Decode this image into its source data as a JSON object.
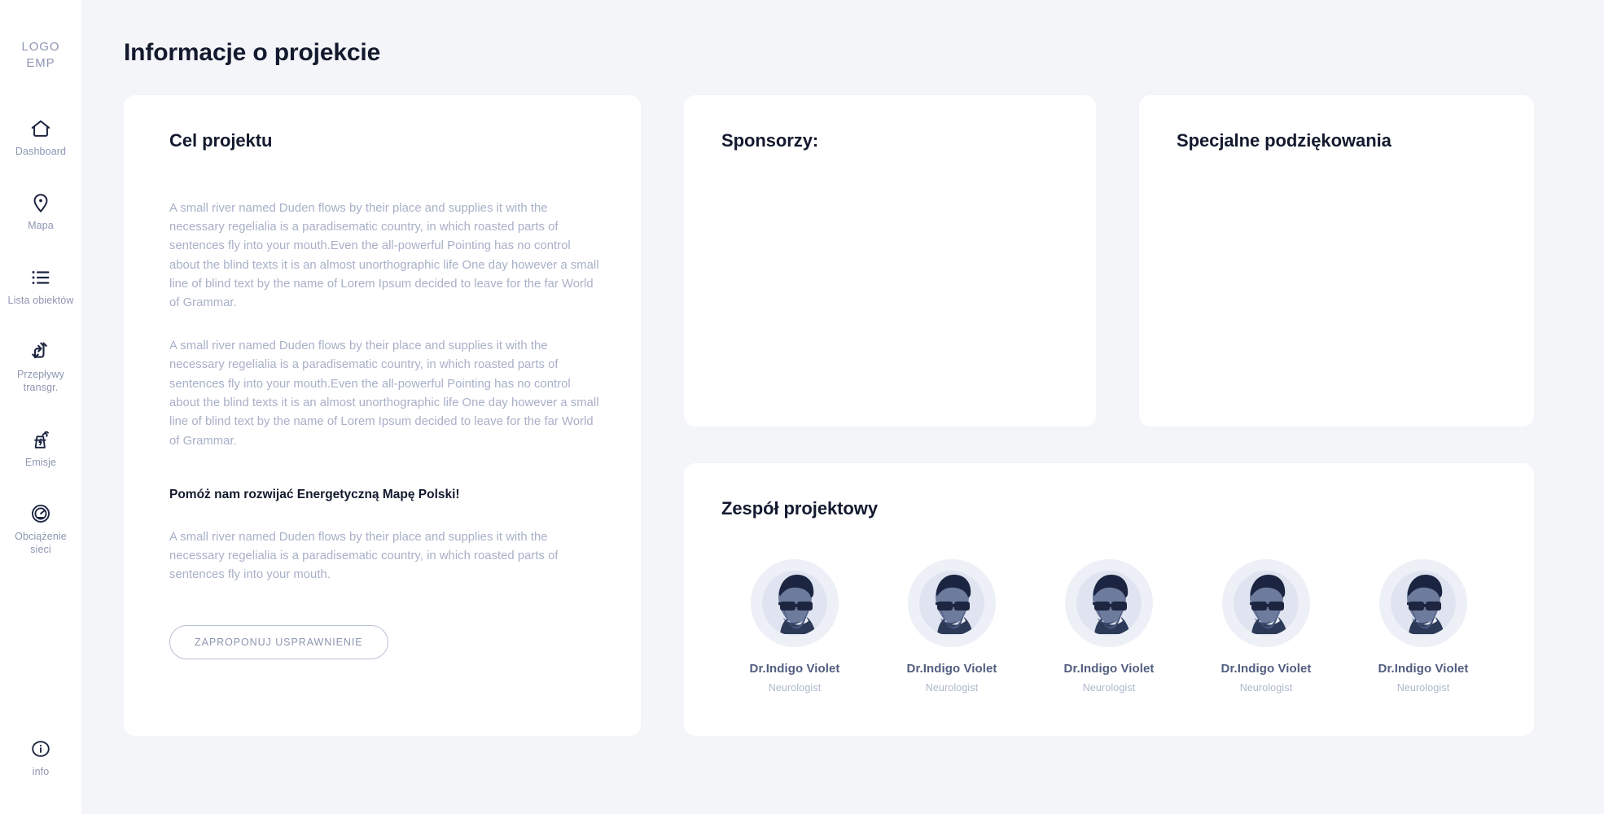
{
  "sidebar": {
    "logo_line1": "LOGO",
    "logo_line2": "EMP",
    "items": [
      {
        "label": "Dashboard",
        "icon": "home-icon"
      },
      {
        "label": "Mapa",
        "icon": "map-pin-icon"
      },
      {
        "label": "Lista obiektów",
        "icon": "list-icon"
      },
      {
        "label": "Przepływy transgr.",
        "icon": "flow-arrows-icon"
      },
      {
        "label": "Emisje",
        "icon": "power-plant-icon"
      },
      {
        "label": "Obciążenie sieci",
        "icon": "gauge-icon"
      }
    ],
    "bottom_item": {
      "label": "info",
      "icon": "info-circle-icon"
    }
  },
  "header": {
    "title": "Informacje o projekcie"
  },
  "goal_card": {
    "title": "Cel projektu",
    "paragraph1": "A small river named Duden flows by their place and supplies it with the necessary regelialia is a paradisematic country, in which roasted parts of sentences fly into your mouth.Even the all-powerful Pointing has no control about the blind texts it is an almost unorthographic life One day however a small line of blind text by the name of Lorem Ipsum decided to leave for the far World of Grammar.",
    "paragraph2": "A small river named Duden flows by their place and supplies it with the necessary regelialia is a paradisematic country, in which roasted parts of sentences fly into your mouth.Even the all-powerful Pointing has no control about the blind texts it is an almost unorthographic life One day however a small line of blind text by the name of Lorem Ipsum decided to leave for the far World of Grammar.",
    "subheading": "Pomóż nam rozwijać Energetyczną Mapę Polski!",
    "paragraph3": "A small river named Duden flows by their place and supplies it with the necessary regelialia is a paradisematic country, in which roasted parts of sentences fly into your mouth.",
    "button_label": "ZAPROPONUJ USPRAWNIENIE"
  },
  "sponsors_card": {
    "title": "Sponsorzy:"
  },
  "thanks_card": {
    "title": "Specjalne podziękowania"
  },
  "team_card": {
    "title": "Zespół projektowy",
    "members": [
      {
        "name": "Dr.Indigo Violet",
        "role": "Neurologist"
      },
      {
        "name": "Dr.Indigo Violet",
        "role": "Neurologist"
      },
      {
        "name": "Dr.Indigo Violet",
        "role": "Neurologist"
      },
      {
        "name": "Dr.Indigo Violet",
        "role": "Neurologist"
      },
      {
        "name": "Dr.Indigo Violet",
        "role": "Neurologist"
      }
    ]
  },
  "colors": {
    "page_background": "#f4f5f9",
    "card_background": "#ffffff",
    "heading_text": "#131a2e",
    "muted_text": "#a8b0c8",
    "sidebar_label": "#8d96b2",
    "icon_stroke": "#1c2440",
    "avatar_background": "#eef0f7"
  }
}
